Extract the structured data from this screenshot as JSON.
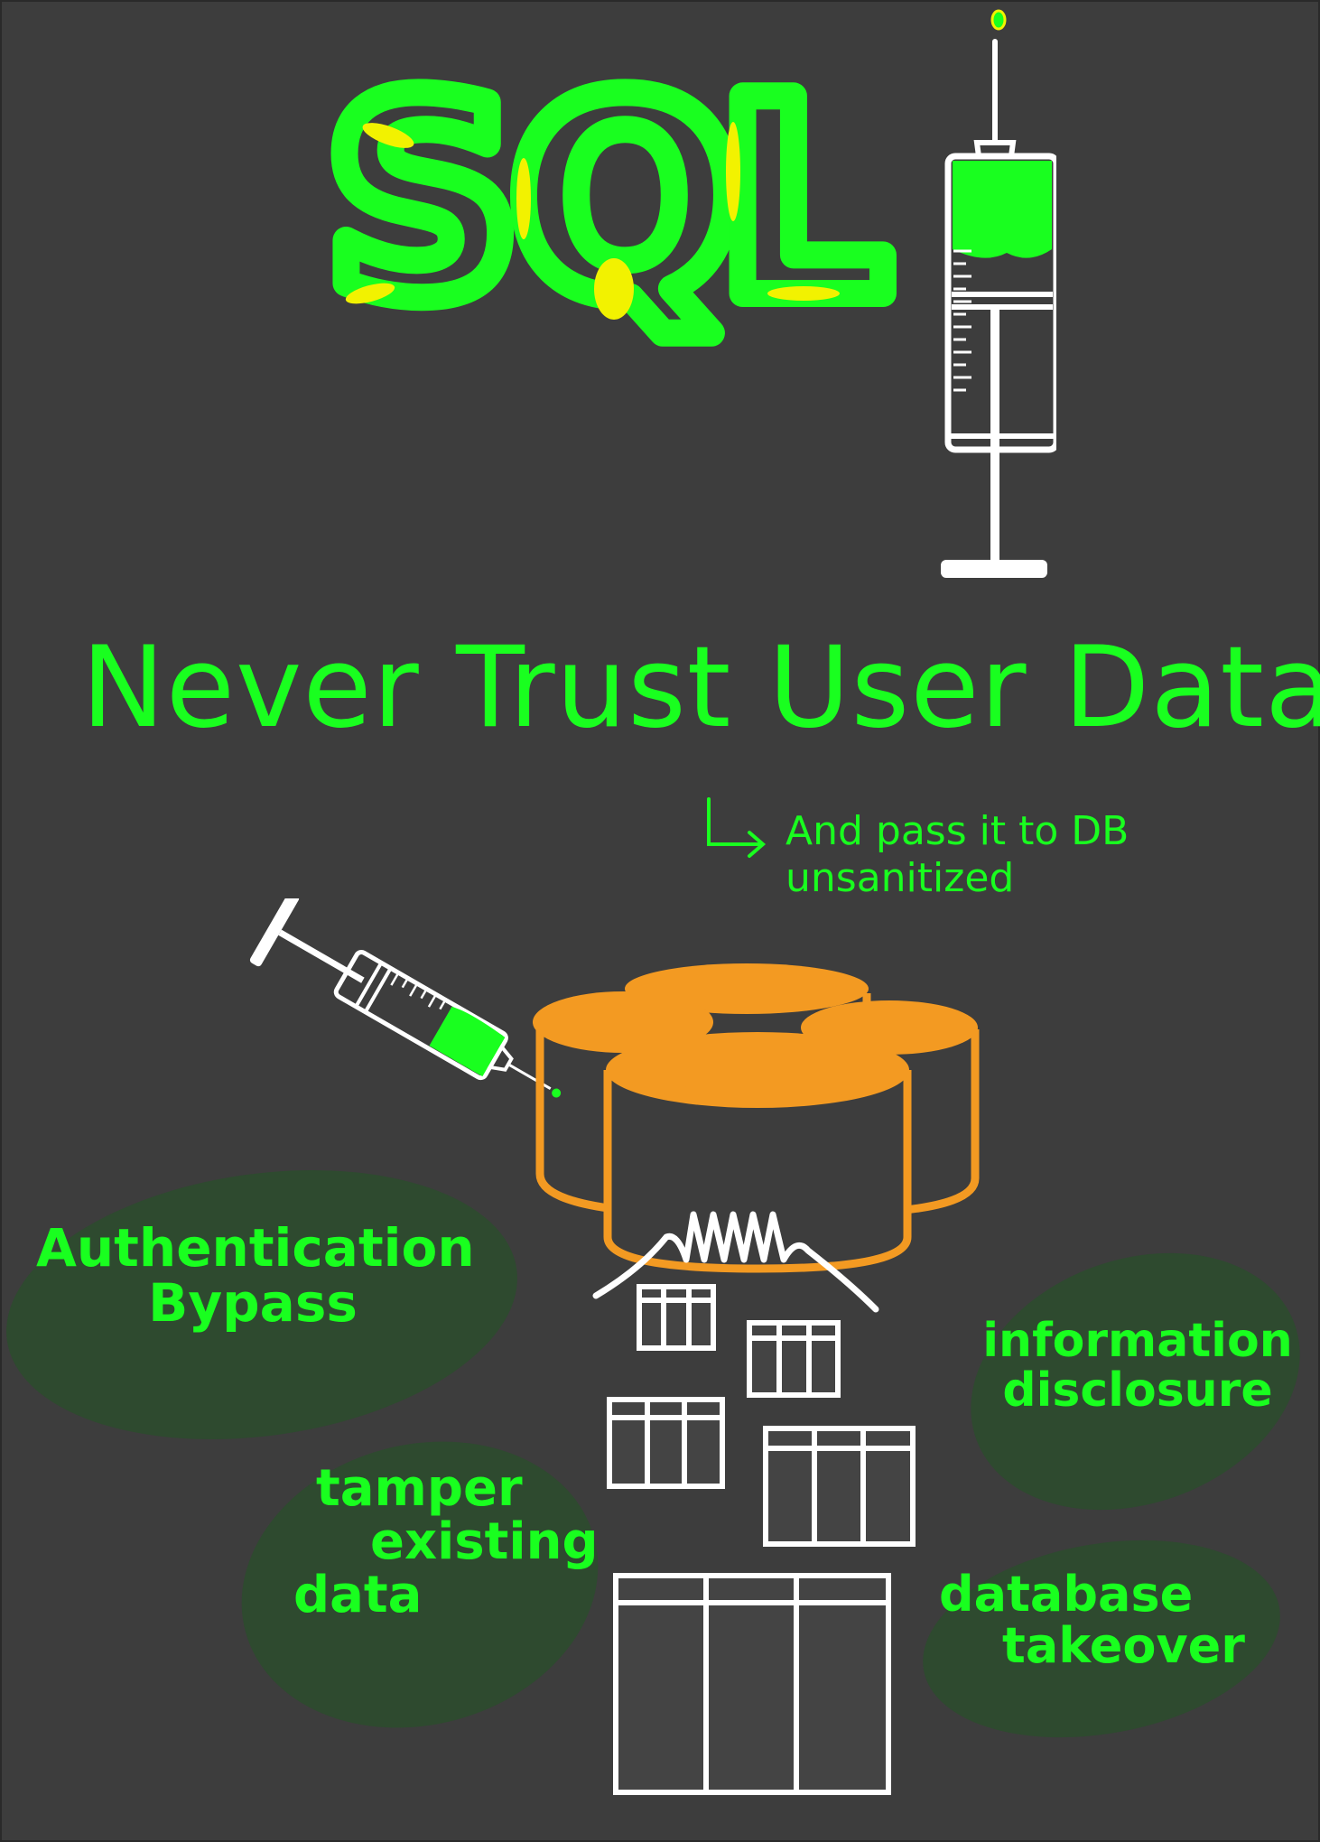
{
  "title": {
    "text": "SQLi",
    "letters": [
      "S",
      "Q",
      "L"
    ]
  },
  "slogan": "Never Trust User Data",
  "note": {
    "line1": "And pass it to DB",
    "line2": "unsanitized"
  },
  "consequences": [
    {
      "lines": [
        "Authentication",
        "Bypass"
      ]
    },
    {
      "lines": [
        "information",
        "disclosure"
      ]
    },
    {
      "lines": [
        "tamper",
        "existing",
        "data"
      ]
    },
    {
      "lines": [
        "database",
        "takeover"
      ]
    }
  ],
  "colors": {
    "background": "#3d3d3d",
    "neon_green": "#19ff1f",
    "yellow_highlight": "#f2f200",
    "orange_db": "#f39a22",
    "blob_green": "#2e4a2f",
    "sketch_white": "#ffffff"
  },
  "icons": [
    "syringe-icon",
    "database-icon",
    "flame-icon",
    "table-icon"
  ]
}
